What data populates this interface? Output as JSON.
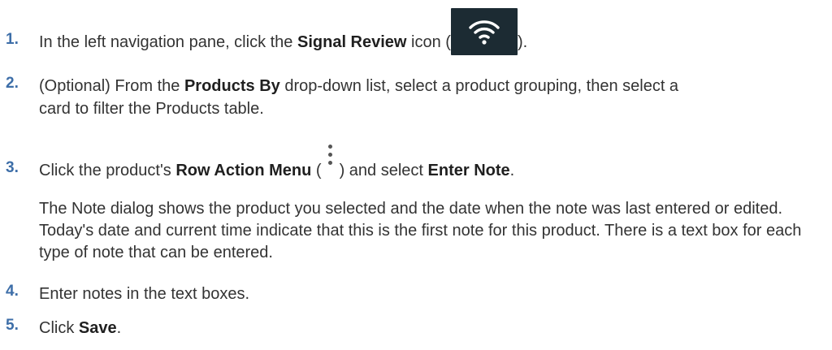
{
  "steps": [
    {
      "num": "1.",
      "before": "In the left navigation pane, click the ",
      "bold1": "Signal Review",
      "mid": " icon (",
      "after": ")."
    },
    {
      "num": "2.",
      "before": "(Optional) From the ",
      "bold1": "Products By",
      "after": " drop-down list, select a product grouping, then select a card to filter the Products table."
    },
    {
      "num": "3.",
      "before": "Click the product's ",
      "bold1": "Row Action Menu",
      "mid": " (",
      "mid2": ") and select ",
      "bold2": "Enter Note",
      "after": "."
    },
    {
      "paragraph": "The Note dialog shows the product you selected and the date when the note was last entered or edited. Today's date and current time indicate that this is the first note for this product. There is a text box for each type of note that can be entered."
    },
    {
      "num": "4.",
      "text": "Enter notes in the text boxes."
    },
    {
      "num": "5.",
      "before": "Click ",
      "bold1": "Save",
      "after": "."
    }
  ],
  "icons": {
    "signal_review": "wifi-signal-icon",
    "row_action_menu": "vertical-ellipsis-icon"
  }
}
